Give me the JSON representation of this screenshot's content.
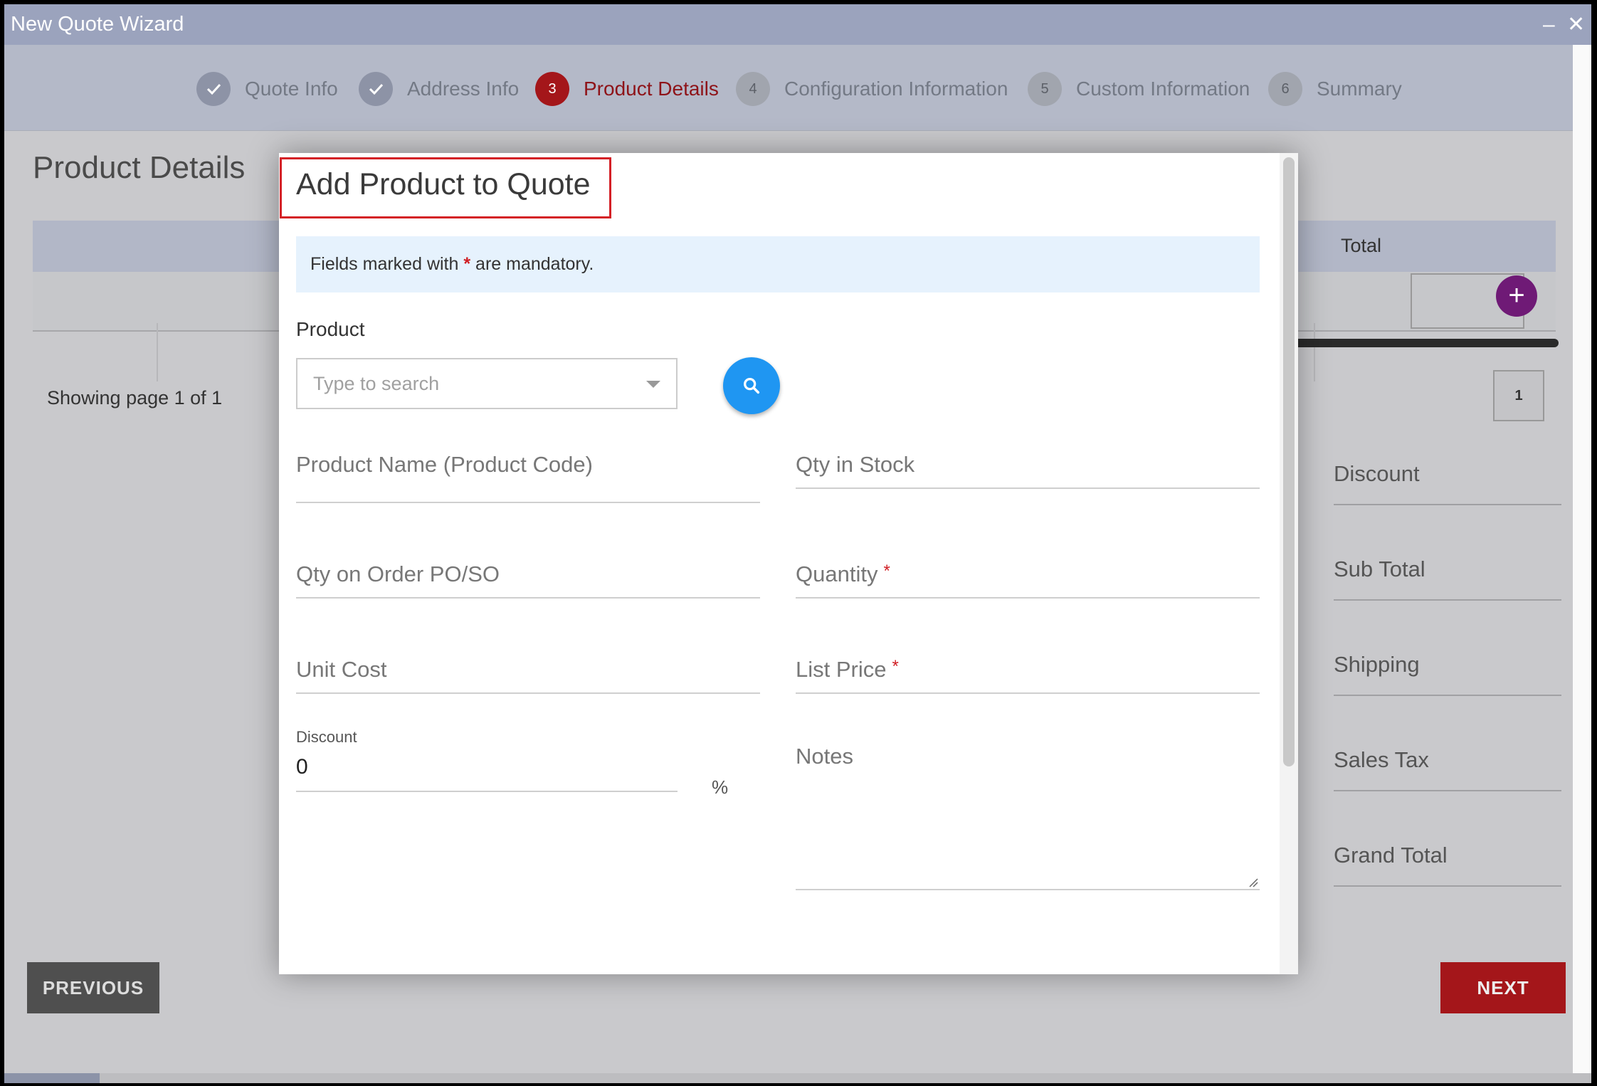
{
  "window": {
    "title": "New Quote Wizard",
    "controls": {
      "minimize": "–",
      "close": "✕"
    }
  },
  "steps": [
    {
      "number": "",
      "label": "Quote Info",
      "state": "done"
    },
    {
      "number": "",
      "label": "Address Info",
      "state": "done"
    },
    {
      "number": "3",
      "label": "Product Details",
      "state": "current"
    },
    {
      "number": "4",
      "label": "Configuration Information",
      "state": "todo"
    },
    {
      "number": "5",
      "label": "Custom Information",
      "state": "todo"
    },
    {
      "number": "6",
      "label": "Summary",
      "state": "todo"
    }
  ],
  "page": {
    "title": "Product Details",
    "table": {
      "total_header": "Total",
      "add_button": "+"
    },
    "pagination": {
      "showing": "Showing page 1 of 1",
      "current_page": "1"
    },
    "summary_fields": [
      "Discount",
      "Sub Total",
      "Shipping",
      "Sales Tax",
      "Grand Total"
    ],
    "previous_label": "PREVIOUS",
    "next_label": "NEXT"
  },
  "modal": {
    "title": "Add Product to Quote",
    "info": {
      "before": "Fields marked with",
      "star": "*",
      "after": "are mandatory."
    },
    "product_label": "Product",
    "product_placeholder": "Type to search",
    "fields": {
      "product_name": "Product Name (Product Code)",
      "qty_in_stock": "Qty in Stock",
      "qty_on_order": "Qty on Order PO/SO",
      "quantity": "Quantity",
      "unit_cost": "Unit Cost",
      "list_price": "List Price",
      "notes": "Notes"
    },
    "required_mark": "*",
    "discount": {
      "label": "Discount",
      "value": "0",
      "unit": "%"
    }
  },
  "colors": {
    "accent_red": "#a4161a",
    "search_blue": "#1f96f2",
    "add_purple": "#6f1a76",
    "highlight_box": "#d42026"
  }
}
